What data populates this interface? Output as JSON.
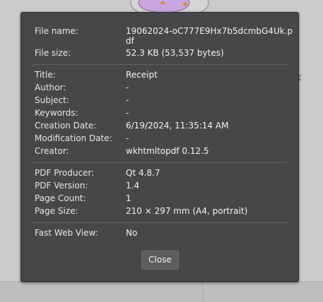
{
  "background": {
    "close_glyph": "×"
  },
  "dialog": {
    "file_group": {
      "file_name": {
        "label": "File name:",
        "value": "19062024-oC777E9Hx7b5dcmbG4Uk.pdf"
      },
      "file_size": {
        "label": "File size:",
        "value": "52.3 KB (53,537 bytes)"
      }
    },
    "doc_group": {
      "title": {
        "label": "Title:",
        "value": "Receipt"
      },
      "author": {
        "label": "Author:",
        "value": "-"
      },
      "subject": {
        "label": "Subject:",
        "value": "-"
      },
      "keywords": {
        "label": "Keywords:",
        "value": "-"
      },
      "creation_date": {
        "label": "Creation Date:",
        "value": "6/19/2024, 11:35:14 AM"
      },
      "modification_date": {
        "label": "Modification Date:",
        "value": "-"
      },
      "creator": {
        "label": "Creator:",
        "value": "wkhtmltopdf 0.12.5"
      }
    },
    "pdf_group": {
      "producer": {
        "label": "PDF Producer:",
        "value": "Qt 4.8.7"
      },
      "version": {
        "label": "PDF Version:",
        "value": "1.4"
      },
      "page_count": {
        "label": "Page Count:",
        "value": "1"
      },
      "page_size": {
        "label": "Page Size:",
        "value": "210 × 297 mm (A4, portrait)"
      }
    },
    "web_group": {
      "fast_web_view": {
        "label": "Fast Web View:",
        "value": "No"
      }
    },
    "close_label": "Close"
  }
}
